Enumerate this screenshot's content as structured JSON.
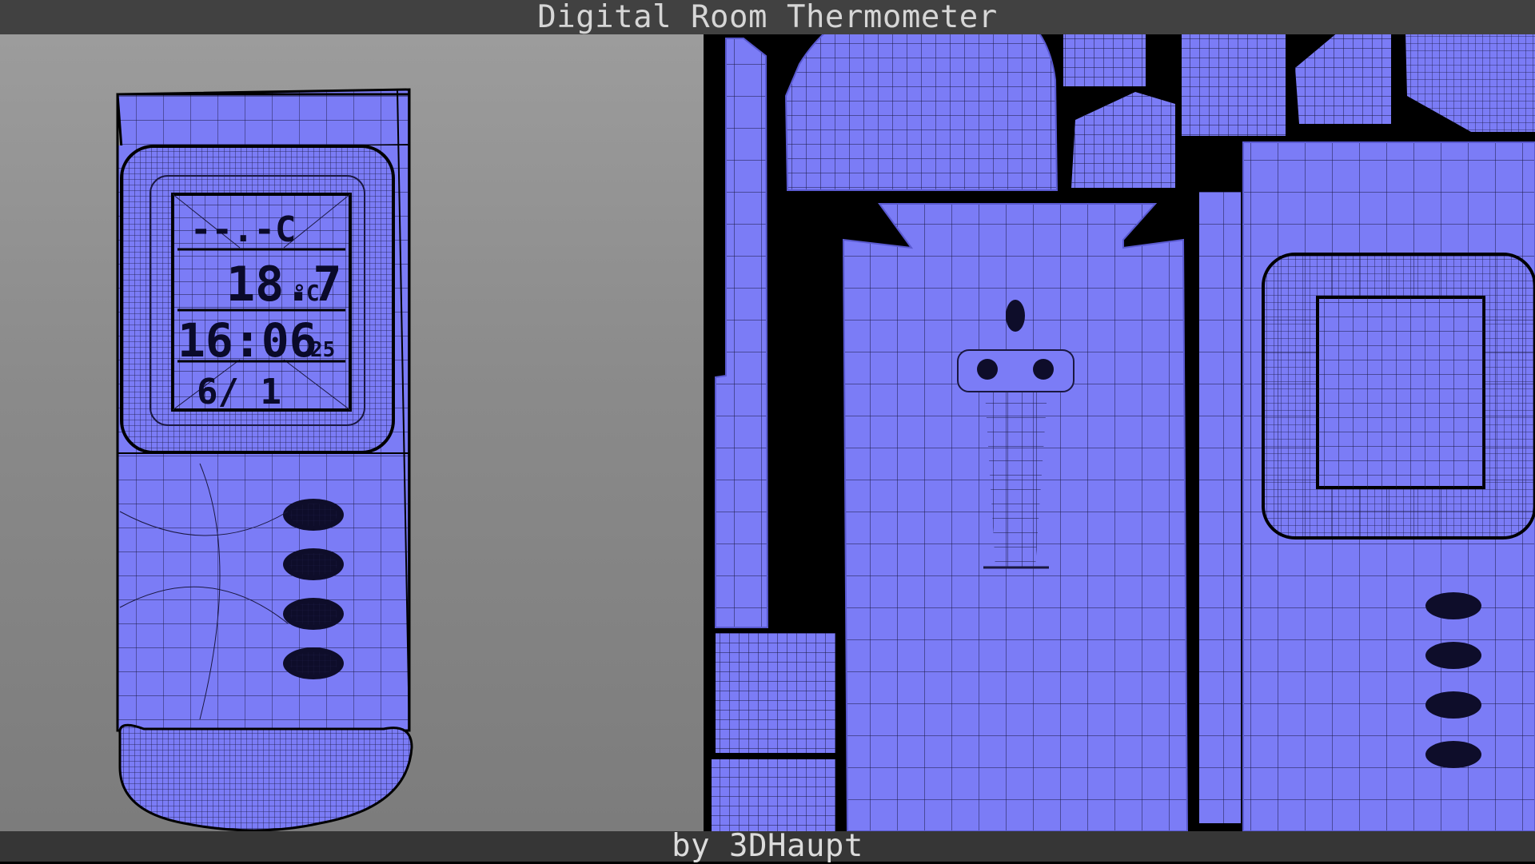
{
  "header": {
    "title": "Digital Room Thermometer"
  },
  "footer": {
    "credit": "by 3DHaupt"
  },
  "model": {
    "lcd_line1": "--.-C",
    "lcd_temp": "18.7",
    "lcd_temp_unit": "°C",
    "lcd_time": "16:06",
    "lcd_seconds": "25",
    "lcd_date": "6/ 1"
  },
  "colors": {
    "mesh_fill": "#7b7cf6",
    "wire": "#1a1840",
    "uv_background": "#000000",
    "viewport_background": "#8f8f8f",
    "bar": "#414141"
  }
}
